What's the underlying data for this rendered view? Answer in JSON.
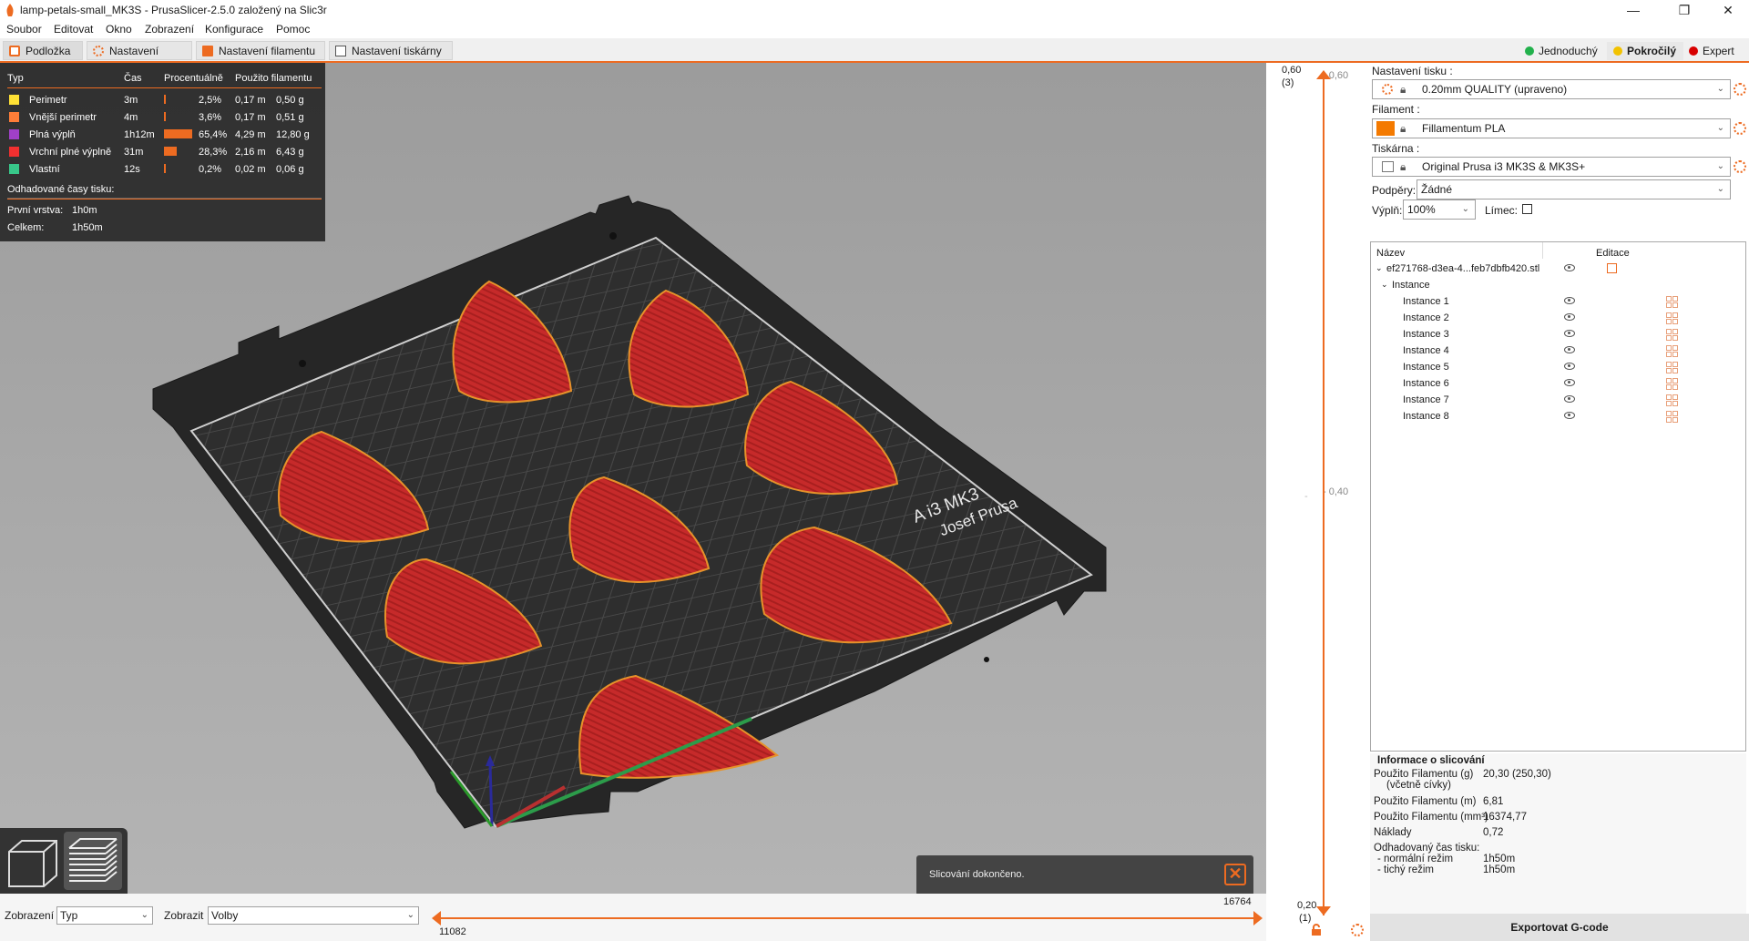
{
  "window": {
    "title": "lamp-petals-small_MK3S - PrusaSlicer-2.5.0 založený na Slic3r",
    "controls": [
      "—",
      "❐",
      "✕"
    ]
  },
  "menu": [
    "Soubor",
    "Editovat",
    "Okno",
    "Zobrazení",
    "Konfigurace",
    "Pomoc"
  ],
  "tabs": [
    "Podložka",
    "Nastavení tisku",
    "Nastavení filamentu",
    "Nastavení tiskárny"
  ],
  "modes": [
    {
      "label": "Jednoduchý",
      "color": "#22b14c"
    },
    {
      "label": "Pokročilý",
      "color": "#f2c200"
    },
    {
      "label": "Expert",
      "color": "#d80000"
    }
  ],
  "legend": {
    "headers": [
      "Typ",
      "Čas",
      "Procentuálně",
      "Použito filamentu"
    ],
    "rows": [
      {
        "name": "Perimetr",
        "time": "3m",
        "percent": "2,5%",
        "fraction": 0.025,
        "length": "0,17 m",
        "weight": "0,50 g",
        "color": "#ffe135"
      },
      {
        "name": "Vnější perimetr",
        "time": "4m",
        "percent": "3,6%",
        "fraction": 0.036,
        "length": "0,17 m",
        "weight": "0,51 g",
        "color": "#ff7d38"
      },
      {
        "name": "Plná výplň",
        "time": "1h12m",
        "percent": "65,4%",
        "fraction": 0.654,
        "length": "4,29 m",
        "weight": "12,80 g",
        "color": "#a040c8"
      },
      {
        "name": "Vrchní plné výplně",
        "time": "31m",
        "percent": "28,3%",
        "fraction": 0.283,
        "length": "2,16 m",
        "weight": "6,43 g",
        "color": "#f03030"
      },
      {
        "name": "Vlastní",
        "time": "12s",
        "percent": "0,2%",
        "fraction": 0.002,
        "length": "0,02 m",
        "weight": "0,06 g",
        "color": "#38c88a"
      }
    ],
    "estimate_title": "Odhadované časy tisku:",
    "first_layer_label": "První vrstva:",
    "first_layer_value": "1h0m",
    "total_label": "Celkem:",
    "total_value": "1h50m"
  },
  "bed_text": [
    "A i3 MK3",
    "Josef Prusa"
  ],
  "toast": {
    "message": "Slicování dokončeno."
  },
  "bottom": {
    "view_label": "Zobrazení",
    "view_value": "Typ",
    "show_label": "Zobrazit",
    "show_value": "Volby",
    "h_min": "11082",
    "h_max": "16764"
  },
  "vslider": {
    "top_value": "0,60",
    "top_layer": "(3)",
    "top_tick": "- 0,60",
    "mid_tick": "- 0,40",
    "bottom_value": "0,20",
    "bottom_layer": "(1)"
  },
  "settings": {
    "print_label": "Nastavení tisku :",
    "print_value": "0.20mm QUALITY (upraveno)",
    "filament_label": "Filament :",
    "filament_value": "Fillamentum PLA",
    "filament_color": "#f47a00",
    "printer_label": "Tiskárna :",
    "printer_value": "Original Prusa i3 MK3S & MK3S+",
    "supports_label": "Podpěry:",
    "supports_value": "Žádné",
    "infill_label": "Výplň:",
    "infill_value": "100%",
    "brim_label": "Límec:"
  },
  "objects": {
    "col_name": "Název",
    "col_edit": "Editace",
    "object_name": "ef271768-d3ea-4...feb7dbfb420.stl",
    "instance_group": "Instance",
    "instances": [
      "Instance 1",
      "Instance 2",
      "Instance 3",
      "Instance 4",
      "Instance 5",
      "Instance 6",
      "Instance 7",
      "Instance 8"
    ]
  },
  "slice_info": {
    "title": "Informace o slicování",
    "rows": [
      {
        "label": "Použito Filamentu (g)",
        "value": "20,30 (250,30)"
      },
      {
        "label": "(včetně cívky)",
        "value": ""
      },
      {
        "label": "Použito Filamentu (m)",
        "value": "6,81"
      },
      {
        "label": "Použito Filamentu (mm³)",
        "value": "16374,77"
      },
      {
        "label": "Náklady",
        "value": "0,72"
      },
      {
        "label": "Odhadovaný čas tisku:",
        "value": ""
      },
      {
        "label": "- normální režim",
        "value": "1h50m"
      },
      {
        "label": "- tichý režim",
        "value": "1h50m"
      }
    ]
  },
  "export_label": "Exportovat G-code"
}
